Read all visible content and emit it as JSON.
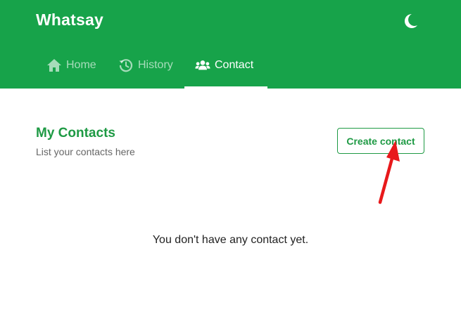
{
  "app": {
    "title": "Whatsay"
  },
  "header": {
    "theme_toggle_icon": "moon-icon"
  },
  "nav": {
    "tabs": [
      {
        "label": "Home",
        "icon": "home-icon",
        "active": false
      },
      {
        "label": "History",
        "icon": "history-icon",
        "active": false
      },
      {
        "label": "Contact",
        "icon": "users-icon",
        "active": true
      }
    ]
  },
  "main": {
    "title": "My Contacts",
    "subtitle": "List your contacts here",
    "create_button_label": "Create contact",
    "empty_message": "You don't have any contact yet."
  },
  "colors": {
    "brand": "#17a34a",
    "accent": "#1e9a44",
    "annotation": "#e8191b"
  }
}
